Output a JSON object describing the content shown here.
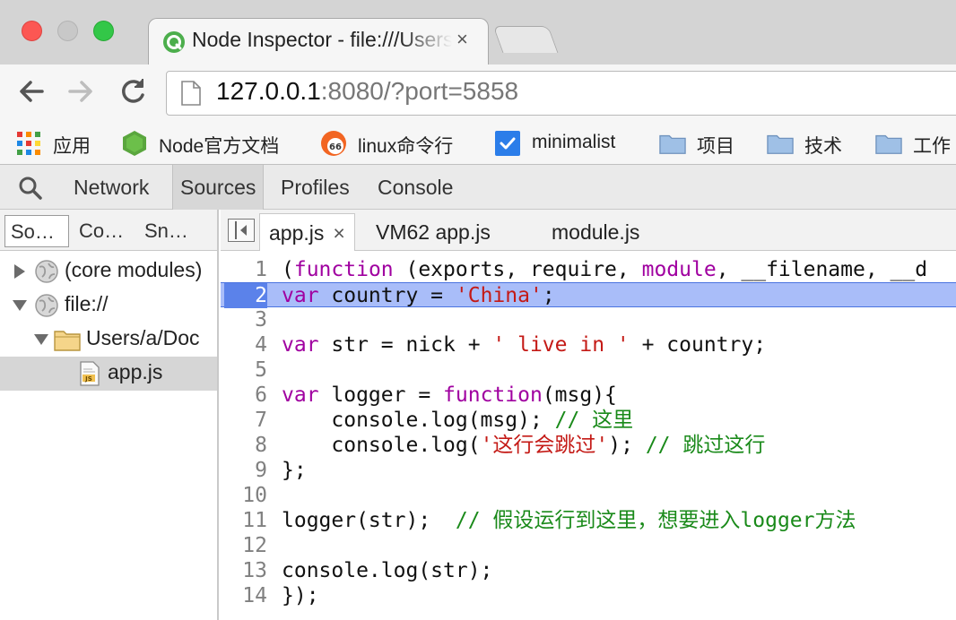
{
  "window": {
    "tab_title": "Node Inspector - file:///Users/a/Doc",
    "tab_close": "×",
    "url_host": "127.0.0.1",
    "url_rest": ":8080/?port=5858"
  },
  "bookmarks": [
    {
      "label": "应用",
      "icon": "apps-grid-icon"
    },
    {
      "label": "Node官方文档",
      "icon": "nodejs-hexagon-icon"
    },
    {
      "label": "linux命令行",
      "icon": "badge-66-icon"
    },
    {
      "label": "minimalist",
      "icon": "checkbox-icon"
    },
    {
      "label": "项目",
      "icon": "folder-icon"
    },
    {
      "label": "技术",
      "icon": "folder-icon"
    },
    {
      "label": "工作",
      "icon": "folder-icon"
    }
  ],
  "devtools": {
    "tabs": [
      "Network",
      "Sources",
      "Profiles",
      "Console"
    ],
    "active_tab": "Sources"
  },
  "navigator": {
    "tabs": [
      "So…",
      "Co…",
      "Sn…"
    ],
    "tree": [
      {
        "label": "(core modules)",
        "icon": "globe-icon",
        "expanded": false,
        "depth": 0
      },
      {
        "label": "file://",
        "icon": "globe-icon",
        "expanded": true,
        "depth": 0
      },
      {
        "label": "Users/a/Doc",
        "icon": "folder-icon",
        "expanded": true,
        "depth": 1
      },
      {
        "label": "app.js",
        "icon": "js-file-icon",
        "selected": true,
        "depth": 2
      }
    ]
  },
  "editor": {
    "tabs": [
      {
        "label": "app.js",
        "close": "×",
        "active": true
      },
      {
        "label": "VM62 app.js"
      },
      {
        "label": "module.js"
      }
    ],
    "highlighted_line": 2,
    "lines": [
      {
        "n": "1",
        "tokens": [
          {
            "t": "(",
            "c": "pl"
          },
          {
            "t": "function",
            "c": "kw"
          },
          {
            "t": " (exports, require, ",
            "c": "pl"
          },
          {
            "t": "module",
            "c": "kw"
          },
          {
            "t": ", __filename, __d",
            "c": "pl"
          }
        ]
      },
      {
        "n": "2",
        "tokens": [
          {
            "t": "var",
            "c": "kw"
          },
          {
            "t": " country = ",
            "c": "pl"
          },
          {
            "t": "'China'",
            "c": "str"
          },
          {
            "t": ";",
            "c": "pl"
          }
        ]
      },
      {
        "n": "3",
        "tokens": []
      },
      {
        "n": "4",
        "tokens": [
          {
            "t": "var",
            "c": "kw"
          },
          {
            "t": " str = nick + ",
            "c": "pl"
          },
          {
            "t": "' live in '",
            "c": "str"
          },
          {
            "t": " + country;",
            "c": "pl"
          }
        ]
      },
      {
        "n": "5",
        "tokens": []
      },
      {
        "n": "6",
        "tokens": [
          {
            "t": "var",
            "c": "kw"
          },
          {
            "t": " logger = ",
            "c": "pl"
          },
          {
            "t": "function",
            "c": "kw"
          },
          {
            "t": "(msg){",
            "c": "pl"
          }
        ]
      },
      {
        "n": "7",
        "tokens": [
          {
            "t": "    console.log(msg); ",
            "c": "pl"
          },
          {
            "t": "// 这里",
            "c": "cm"
          }
        ]
      },
      {
        "n": "8",
        "tokens": [
          {
            "t": "    console.log(",
            "c": "pl"
          },
          {
            "t": "'这行会跳过'",
            "c": "str"
          },
          {
            "t": "); ",
            "c": "pl"
          },
          {
            "t": "// 跳过这行",
            "c": "cm"
          }
        ]
      },
      {
        "n": "9",
        "tokens": [
          {
            "t": "};",
            "c": "pl"
          }
        ]
      },
      {
        "n": "10",
        "tokens": []
      },
      {
        "n": "11",
        "tokens": [
          {
            "t": "logger(str);  ",
            "c": "pl"
          },
          {
            "t": "// 假设运行到这里，想要进入logger方法",
            "c": "cm"
          }
        ]
      },
      {
        "n": "12",
        "tokens": []
      },
      {
        "n": "13",
        "tokens": [
          {
            "t": "console.log(str);",
            "c": "pl"
          }
        ]
      },
      {
        "n": "14",
        "tokens": [
          {
            "t": "});",
            "c": "pl"
          }
        ]
      }
    ]
  },
  "colors": {
    "highlight_line": "#a9bdf9",
    "highlight_gutter": "#5b82ea",
    "keyword": "#a000a0",
    "string": "#c41a16",
    "comment": "#1a8a1a"
  }
}
